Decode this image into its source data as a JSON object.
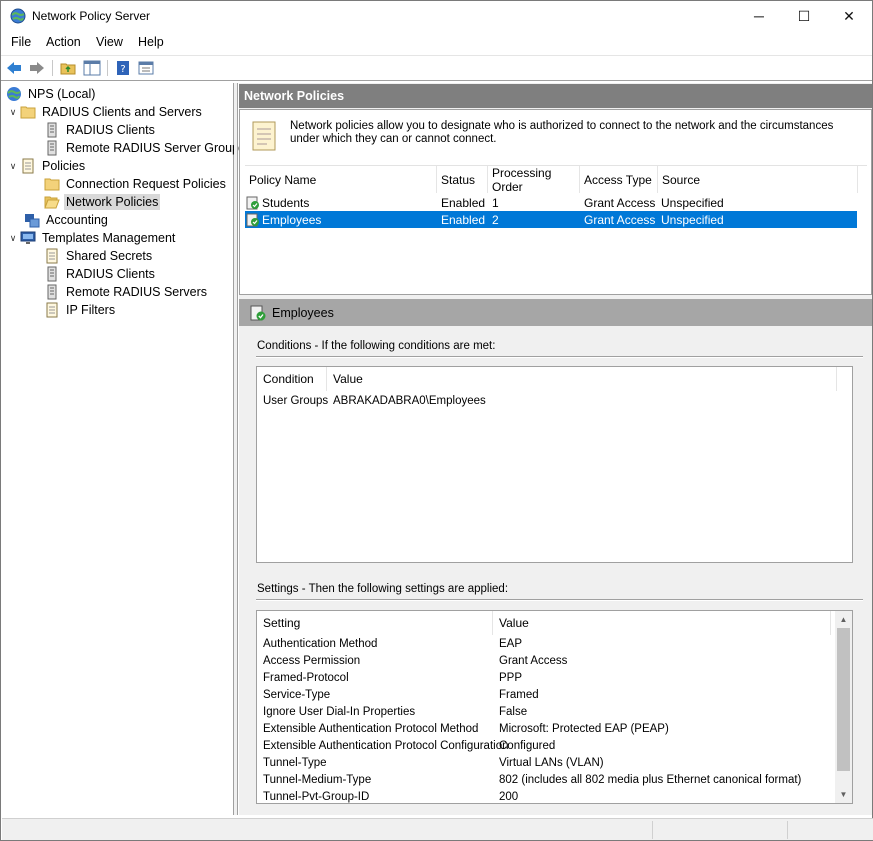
{
  "window": {
    "title": "Network Policy Server",
    "app_icon": "globe-icon"
  },
  "window_controls": {
    "minimize": "─",
    "maximize": "☐",
    "close": "✕"
  },
  "menu": [
    "File",
    "Action",
    "View",
    "Help"
  ],
  "toolbar": [
    "back-icon",
    "forward-icon",
    "up-folder-icon",
    "show-hide-tree-icon",
    "help-icon",
    "properties-icon"
  ],
  "tree": {
    "items": [
      {
        "label": "NPS (Local)",
        "icon": "globe-icon"
      },
      {
        "label": "RADIUS Clients and Servers",
        "icon": "folder-icon",
        "expanded": true
      },
      {
        "label": "RADIUS Clients",
        "icon": "server-icon"
      },
      {
        "label": "Remote RADIUS Server Groups",
        "icon": "server-icon"
      },
      {
        "label": "Policies",
        "icon": "doc-icon",
        "expanded": true
      },
      {
        "label": "Connection Request Policies",
        "icon": "folder-icon"
      },
      {
        "label": "Network Policies",
        "icon": "folder-open-icon",
        "selected": true
      },
      {
        "label": "Accounting",
        "icon": "accounting-icon"
      },
      {
        "label": "Templates Management",
        "icon": "monitor-icon",
        "expanded": true
      },
      {
        "label": "Shared Secrets",
        "icon": "doc-icon"
      },
      {
        "label": "RADIUS Clients",
        "icon": "server-icon"
      },
      {
        "label": "Remote RADIUS Servers",
        "icon": "server-icon"
      },
      {
        "label": "IP Filters",
        "icon": "doc-icon"
      }
    ]
  },
  "main": {
    "header": "Network Policies",
    "description": "Network policies allow you to designate who is authorized to connect to the network and the circumstances under which they can or cannot connect.",
    "columns": [
      "Policy Name",
      "Status",
      "Processing Order",
      "Access Type",
      "Source"
    ],
    "policies": [
      {
        "name": "Students",
        "status": "Enabled",
        "order": "1",
        "access": "Grant Access",
        "source": "Unspecified"
      },
      {
        "name": "Employees",
        "status": "Enabled",
        "order": "2",
        "access": "Grant Access",
        "source": "Unspecified",
        "selected": true
      }
    ]
  },
  "detail": {
    "title": "Employees",
    "conditions_label": "Conditions - If the following conditions are met:",
    "conditions_columns": [
      "Condition",
      "Value"
    ],
    "conditions": [
      {
        "condition": "User Groups",
        "value": "ABRAKADABRA0\\Employees"
      }
    ],
    "settings_label": "Settings - Then the following settings are applied:",
    "settings_columns": [
      "Setting",
      "Value"
    ],
    "settings": [
      {
        "setting": "Authentication Method",
        "value": "EAP"
      },
      {
        "setting": "Access Permission",
        "value": "Grant Access"
      },
      {
        "setting": "Framed-Protocol",
        "value": "PPP"
      },
      {
        "setting": "Service-Type",
        "value": "Framed"
      },
      {
        "setting": "Ignore User Dial-In Properties",
        "value": "False"
      },
      {
        "setting": "Extensible Authentication Protocol Method",
        "value": "Microsoft: Protected EAP (PEAP)"
      },
      {
        "setting": "Extensible Authentication Protocol Configuration",
        "value": "Configured"
      },
      {
        "setting": "Tunnel-Type",
        "value": "Virtual LANs (VLAN)"
      },
      {
        "setting": "Tunnel-Medium-Type",
        "value": "802 (includes all 802 media plus Ethernet canonical format)"
      },
      {
        "setting": "Tunnel-Pvt-Group-ID",
        "value": "200"
      }
    ]
  }
}
